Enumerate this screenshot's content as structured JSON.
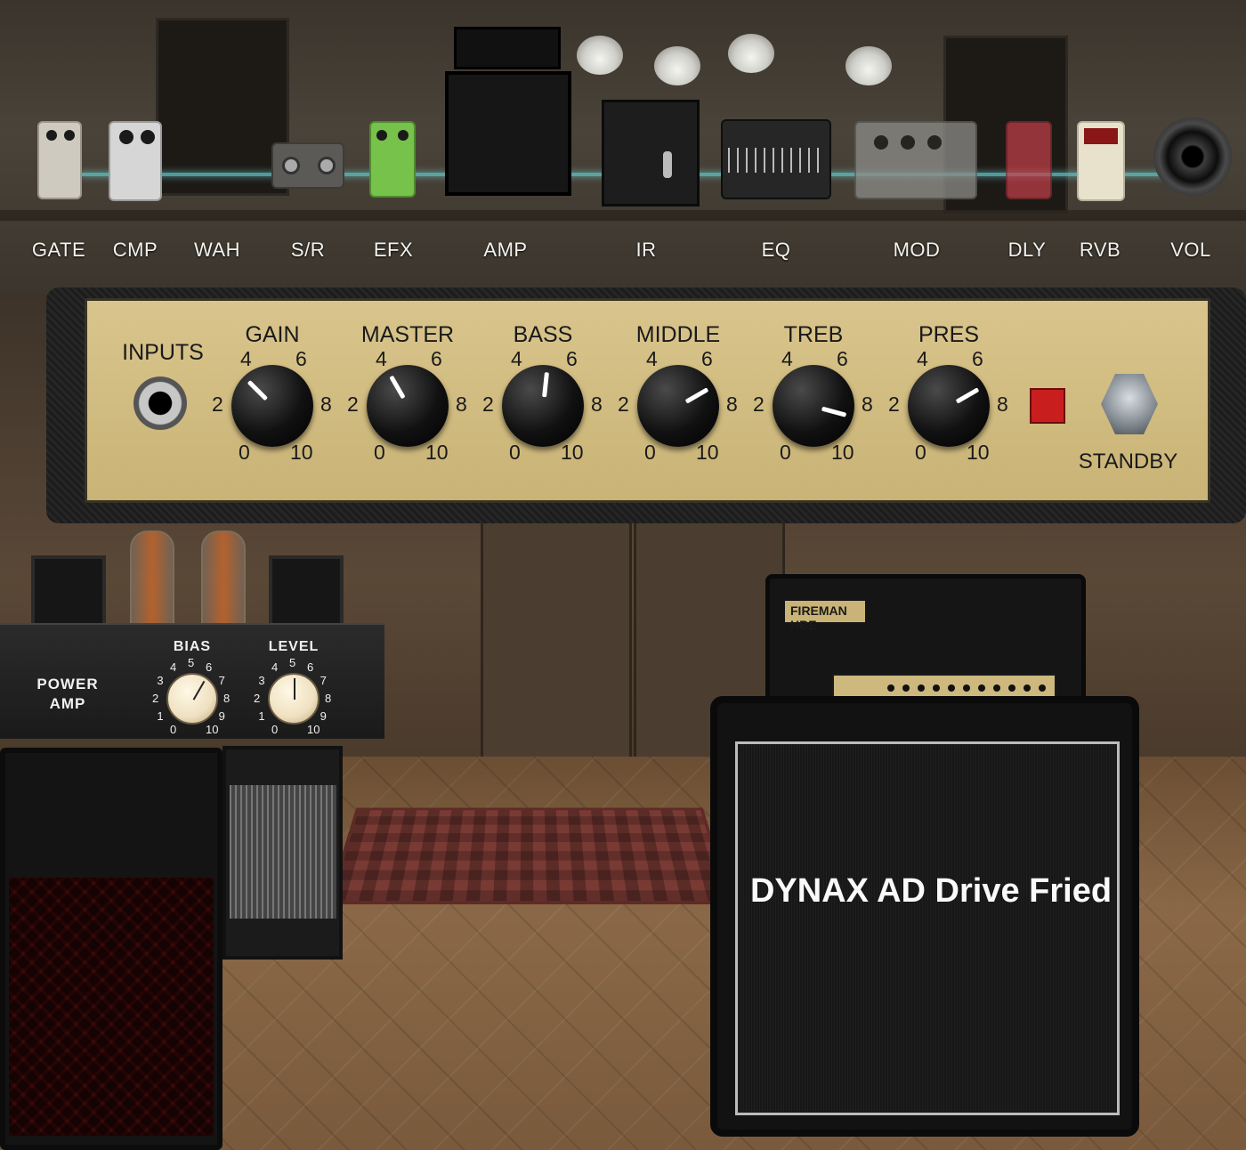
{
  "chain": {
    "items": [
      {
        "label": "GATE"
      },
      {
        "label": "CMP"
      },
      {
        "label": "WAH"
      },
      {
        "label": "S/R"
      },
      {
        "label": "EFX"
      },
      {
        "label": "AMP"
      },
      {
        "label": "IR"
      },
      {
        "label": "EQ"
      },
      {
        "label": "MOD"
      },
      {
        "label": "DLY"
      },
      {
        "label": "RVB"
      },
      {
        "label": "VOL"
      }
    ]
  },
  "amp": {
    "inputs_label": "INPUTS",
    "standby_label": "STANDBY",
    "scale": {
      "n0": "0",
      "n2": "2",
      "n4": "4",
      "n6": "6",
      "n8": "8",
      "n10": "10"
    },
    "knobs": [
      {
        "label": "GAIN",
        "value": 3.5
      },
      {
        "label": "MASTER",
        "value": 4
      },
      {
        "label": "BASS",
        "value": 5.2
      },
      {
        "label": "MIDDLE",
        "value": 7
      },
      {
        "label": "TREB",
        "value": 8.5
      },
      {
        "label": "PRES",
        "value": 7
      }
    ]
  },
  "power_amp": {
    "label_line1": "POWER",
    "label_line2": "AMP",
    "knobs": [
      {
        "label": "BIAS",
        "value": 6
      },
      {
        "label": "LEVEL",
        "value": 5
      }
    ],
    "scale": [
      "0",
      "1",
      "2",
      "3",
      "4",
      "5",
      "6",
      "7",
      "8",
      "9",
      "10"
    ]
  },
  "head": {
    "logo": "FIREMAN HBE"
  },
  "cabinet": {
    "name": "DYNAX AD Drive Fried"
  },
  "colors": {
    "cable": "#5fc6c8",
    "amp_face": "#d9c58c",
    "standby_led": "#c81e1e"
  }
}
